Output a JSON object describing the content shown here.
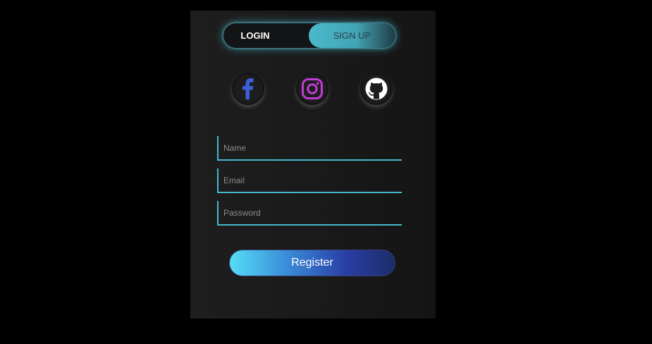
{
  "auth_toggle": {
    "login_label": "LOGIN",
    "signup_label": "SIGN UP",
    "active": "signup"
  },
  "social": [
    {
      "icon": "facebook-icon",
      "color": "#3b5fd9"
    },
    {
      "icon": "instagram-icon",
      "color": "#c13bd6"
    },
    {
      "icon": "github-icon",
      "color": "#ffffff"
    }
  ],
  "form": {
    "name_placeholder": "Name",
    "email_placeholder": "Email",
    "password_placeholder": "Password",
    "name_value": "",
    "email_value": "",
    "password_value": "",
    "submit_label": "Register"
  },
  "colors": {
    "accent": "#45b8c9",
    "background": "#000000",
    "card": "#1a1a1b"
  }
}
